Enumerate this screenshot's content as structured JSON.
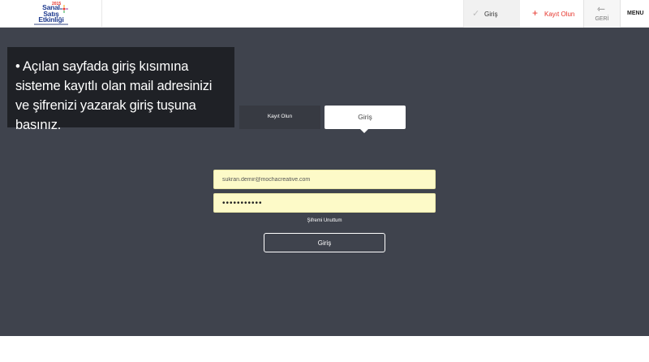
{
  "header": {
    "logo": {
      "year": "2015",
      "line1": "Sanal",
      "line2": "Satış",
      "line3": "Etkinliği"
    },
    "nav": {
      "login_label": "Giriş",
      "login_icon": "check-icon",
      "register_label": "Kayıt Olun",
      "register_icon": "plus-icon",
      "back_label": "GERİ",
      "back_icon": "arrow-left-icon",
      "menu_label": "MENU"
    }
  },
  "note": {
    "text": "• Açılan sayfada giriş kısımına sisteme kayıtlı olan mail adresinizi ve şifrenizi yazarak giriş tuşuna basınız."
  },
  "tabs": {
    "register": "Kayıt Olun",
    "login": "Giriş"
  },
  "form": {
    "email_value": "sukran.demir@mochacreative.com",
    "password_value": "•••••••••••",
    "forgot_label": "Şifremi Unuttum",
    "submit_label": "Giriş"
  },
  "colors": {
    "background": "#3f434d",
    "note_background": "#1f2126",
    "input_background": "#fdfac8",
    "accent_red": "#e6332a",
    "logo_blue": "#1f3b8f"
  }
}
